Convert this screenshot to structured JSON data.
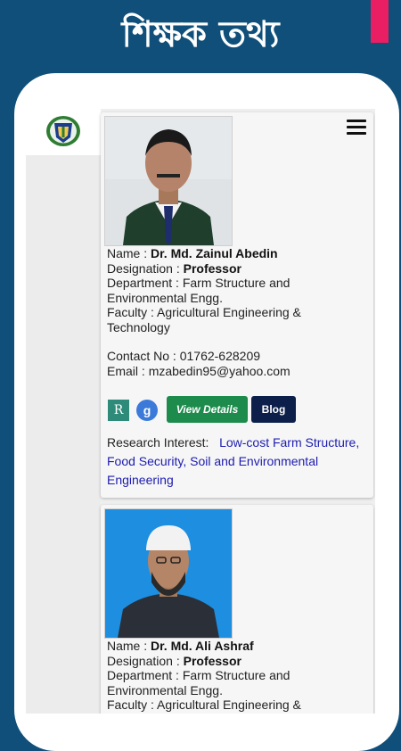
{
  "header": {
    "title": "শিক্ষক তথ্য",
    "accent_color": "#e91e63",
    "background_color": "#0f4f79"
  },
  "sidebar": {
    "logo_icon": "university-logo-icon"
  },
  "menu": {
    "icon": "hamburger-menu-icon"
  },
  "teachers": [
    {
      "name_label": "Name :",
      "name": "Dr. Md. Zainul Abedin",
      "designation_label": "Designation :",
      "designation": "Professor",
      "department_label": "Department :",
      "department": "Farm Structure and Environmental Engg.",
      "faculty_label": "Faculty :",
      "faculty": "Agricultural Engineering & Technology",
      "contact_label": "Contact No :",
      "contact": "01762-628209",
      "email_label": "Email :",
      "email": "mzabedin95@yahoo.com",
      "researchgate_label": "R",
      "scholar_label": "g",
      "details_button": "View Details",
      "blog_button": "Blog",
      "research_label": "Research Interest:",
      "research": "Low-cost Farm Structure, Food Security, Soil and Environmental Engineering"
    },
    {
      "name_label": "Name :",
      "name": "Dr. Md. Ali Ashraf",
      "designation_label": "Designation :",
      "designation": "Professor",
      "department_label": "Department :",
      "department": "Farm Structure and Environmental Engg.",
      "faculty_label": "Faculty :",
      "faculty": "Agricultural Engineering &"
    }
  ]
}
